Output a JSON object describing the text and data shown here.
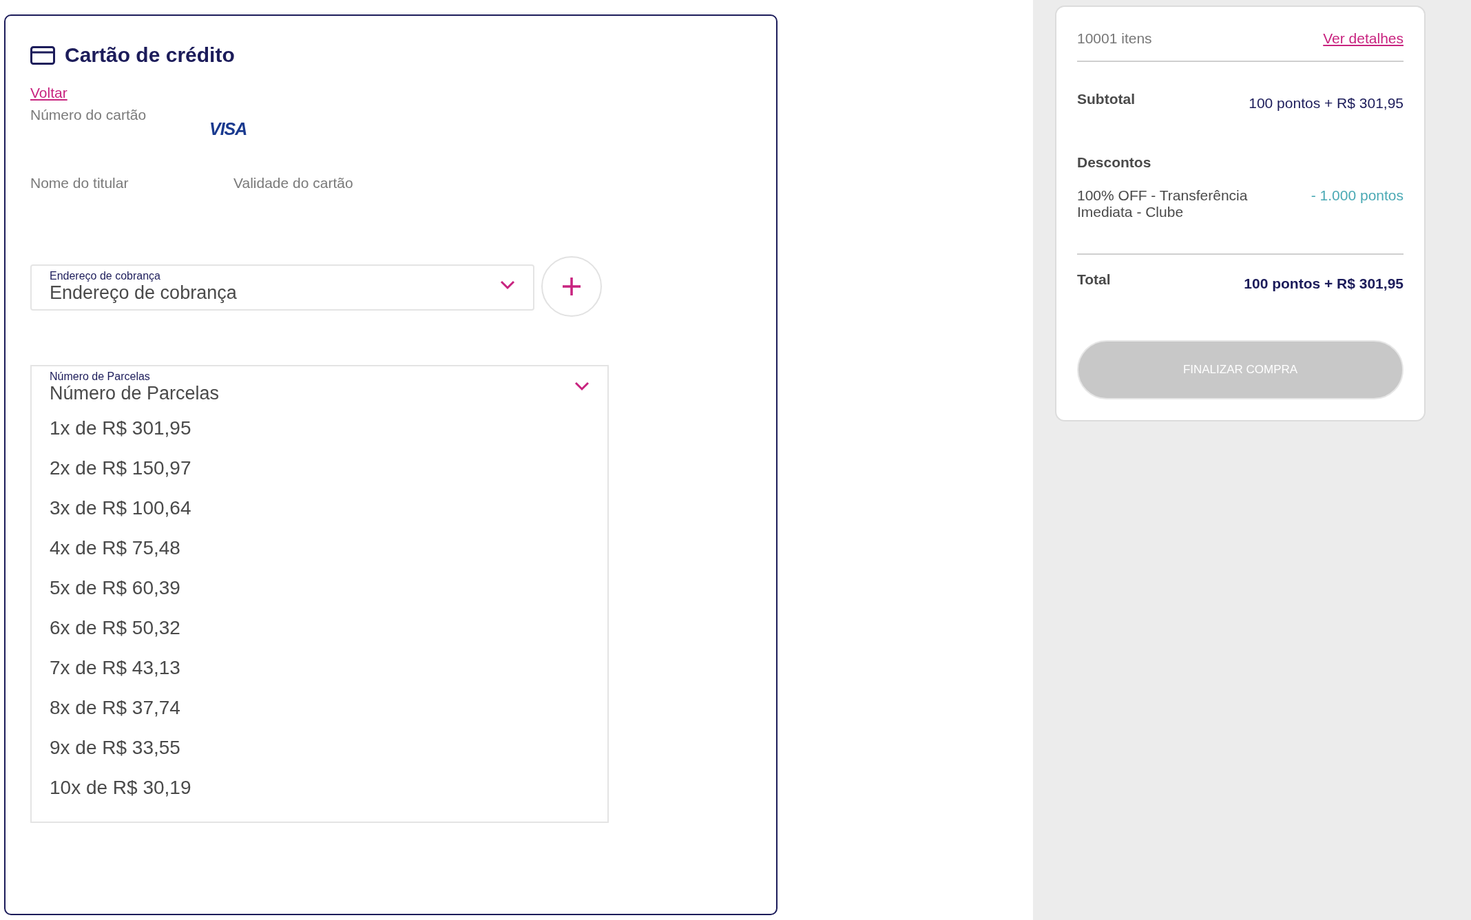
{
  "payment": {
    "title": "Cartão de crédito",
    "back_link": "Voltar",
    "card_number": {
      "placeholder": "Número do cartão"
    },
    "card_brand": "VISA",
    "holder_name": {
      "placeholder": "Nome do titular"
    },
    "expiry": {
      "placeholder": "Validade do cartão"
    },
    "billing_address": {
      "label": "Endereço de cobrança",
      "value": "Endereço de cobrança",
      "expanded": false
    },
    "installments": {
      "label": "Número de Parcelas",
      "value": "Número de Parcelas",
      "expanded": true,
      "options": [
        {
          "label": "1x de R$ 301,95",
          "selected": false
        },
        {
          "label": "2x de R$ 150,97",
          "selected": false
        },
        {
          "label": "3x de R$ 100,64",
          "selected": false
        },
        {
          "label": "4x de R$ 75,48",
          "selected": false
        },
        {
          "label": "5x de R$ 60,39",
          "selected": false
        },
        {
          "label": "6x de R$ 50,32",
          "selected": false
        },
        {
          "label": "7x de R$ 43,13",
          "selected": false
        },
        {
          "label": "8x de R$ 37,74",
          "selected": false
        },
        {
          "label": "9x de R$ 33,55",
          "selected": false
        },
        {
          "label": "10x de R$ 30,19",
          "selected": false
        }
      ]
    }
  },
  "summary": {
    "items_count": "10001 itens",
    "details_link": "Ver detalhes",
    "subtotal": {
      "label": "Subtotal",
      "value": "100 pontos + R$ 301,95"
    },
    "discounts_title": "Descontos",
    "discounts": [
      {
        "label": "100% OFF - Transferência Imediata - Clube",
        "value": "- 1.000 pontos"
      }
    ],
    "total": {
      "label": "Total",
      "value": "100 pontos + R$ 301,95"
    },
    "checkout_button": {
      "label": "FINALIZAR COMPRA",
      "disabled": true
    }
  }
}
